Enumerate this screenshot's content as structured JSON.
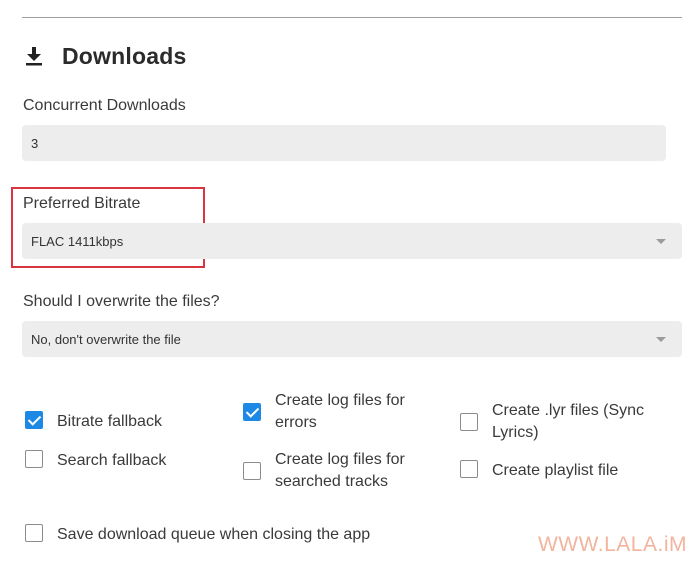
{
  "section": {
    "icon": "download-icon",
    "title": "Downloads"
  },
  "concurrent_downloads": {
    "label": "Concurrent Downloads",
    "value": "3"
  },
  "preferred_bitrate": {
    "label": "Preferred Bitrate",
    "selected": "FLAC 1411kbps"
  },
  "overwrite": {
    "label": "Should I overwrite the files?",
    "selected": "No, don't overwrite the file"
  },
  "checkboxes": [
    {
      "label": "Bitrate fallback",
      "checked": true
    },
    {
      "label": "Create log files for errors",
      "checked": true
    },
    {
      "label": "Create .lyr files (Sync Lyrics)",
      "checked": false
    },
    {
      "label": "Search fallback",
      "checked": false
    },
    {
      "label": "Create log files for searched tracks",
      "checked": false
    },
    {
      "label": "Create playlist file",
      "checked": false
    },
    {
      "label": "Save download queue when closing the app",
      "checked": false
    }
  ],
  "colors": {
    "checkbox_accent": "#1e88e5",
    "highlight": "#d9343f",
    "watermark": "#f2b49e"
  },
  "watermark": "WWW.LALA.iM"
}
